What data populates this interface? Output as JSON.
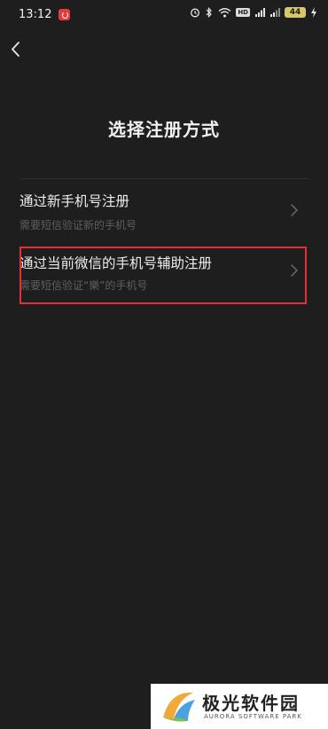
{
  "status_bar": {
    "time": "13:12",
    "hd": "HD",
    "battery": "44"
  },
  "header": {
    "title": "选择注册方式"
  },
  "options": [
    {
      "title": "通过新手机号注册",
      "subtitle": "需要短信验证新的手机号"
    },
    {
      "title": "通过当前微信的手机号辅助注册",
      "subtitle": "需要短信验证“樂”的手机号"
    }
  ],
  "watermark": {
    "name": "极光软件园",
    "sub": "AURORA SOFTWARE PARK"
  },
  "colors": {
    "background": "#1e1e1e",
    "highlight": "#e53030"
  }
}
